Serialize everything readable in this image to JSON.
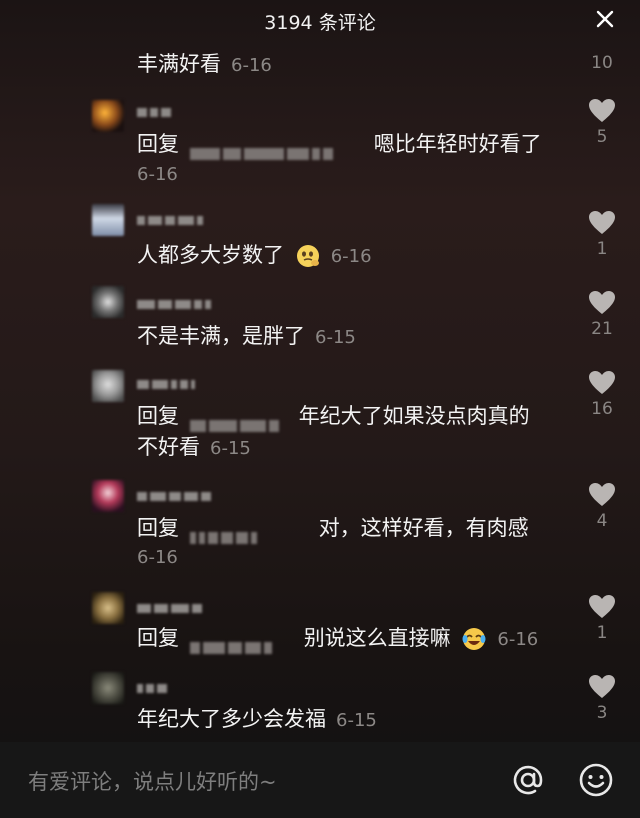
{
  "header": {
    "title": "3194 条评论"
  },
  "top_partial": {
    "text": "丰满好看",
    "date": "6-16",
    "likes": "10"
  },
  "comments": [
    {
      "text": "嗯比年轻时好看了",
      "date": "6-16",
      "likes": "5",
      "prefix": "回复"
    },
    {
      "text": "人都多大岁数了",
      "date": "6-16",
      "likes": "1"
    },
    {
      "text": "不是丰满，是胖了",
      "date": "6-15",
      "likes": "21"
    },
    {
      "text_line1": "年纪大了如果没点肉真的",
      "text_line2": "不好看",
      "date": "6-15",
      "likes": "16",
      "prefix": "回复"
    },
    {
      "text": "对，这样好看，有肉感",
      "date": "6-16",
      "likes": "4",
      "prefix": "回复"
    },
    {
      "text": "别说这么直接嘛",
      "date": "6-16",
      "likes": "1",
      "prefix": "回复"
    },
    {
      "text": "年纪大了多少会发福",
      "date": "6-15",
      "likes": "3"
    }
  ],
  "input": {
    "placeholder": "有爱评论，说点儿好听的~"
  },
  "colors": {
    "background": "#231918",
    "bottom_bar": "#171717",
    "muted": "#8c8886",
    "like_icon": "#b9b5b3"
  },
  "icons": {
    "close": "close-icon",
    "like": "heart-icon",
    "mention": "at-icon",
    "emoji": "smiley-icon"
  }
}
